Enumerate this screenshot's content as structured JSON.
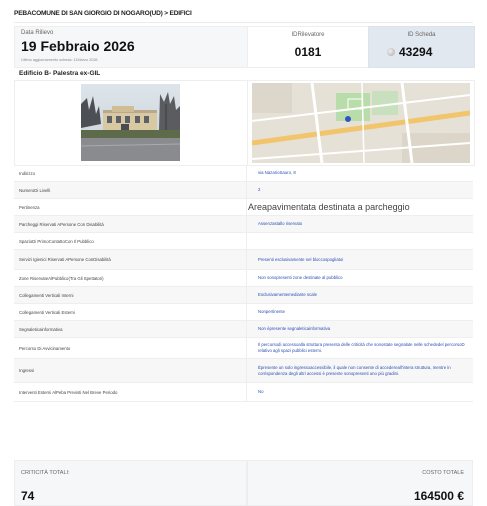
{
  "breadcrumb": "PEBACOMUNE DI SAN GIORGIO DI NOGARO(UD) > EDIFICI",
  "header": {
    "date_label": "Data Rilievo",
    "date_value": "19 Febbraio 2026",
    "updated_text": "Ultimo aggiornamento scheda: 11Marzo 2026",
    "rilevatore_label": "IDRilevatore",
    "rilevatore_value": "0181",
    "scheda_label": "ID Scheda",
    "scheda_value": "43294"
  },
  "building_name": "Edificio B- Palestra ex-GIL",
  "rows": [
    {
      "label": "Indirizzo",
      "value": "via NazarioSauro, 8"
    },
    {
      "label": "NumeroDi Livelli",
      "value": "2"
    },
    {
      "label": "Pertinenza",
      "value": "Areapavimentata destinata a parcheggio"
    },
    {
      "label": "Parcheggi Riservati APersone Con Disabilità",
      "value": "Assenzastallo riservato"
    },
    {
      "label": "SpazioDi PrimoContattoCon Il Pubblico",
      "value": ""
    },
    {
      "label": "Servizi Igienici Riservati APersone ConDisabilità",
      "value": "Presenti esclusivamente nel bloccospogliatoi"
    },
    {
      "label": "Zone RiservateAlPubblico(Tra Gli Spettatori)",
      "value": "Non sonopresenti zone destinate al pubblico"
    },
    {
      "label": "Collegamenti Verticali Interni",
      "value": "Esclusivamentemediante scale"
    },
    {
      "label": "Collegamenti Verticali Esterni",
      "value": "Nonpertinente"
    },
    {
      "label": "Segnaleticainformativa",
      "value": "Non èpresente segnaleticainformativa"
    },
    {
      "label": "Percorso Di Avvicinamento",
      "value": "Il percorsodi accessoalla struttura presenta delle criticità che sonostate segnalate nelle schededel percorsoD relativo agli spazi pubblici esterni."
    },
    {
      "label": "Ingressi",
      "value": "Èpresente un solo ingressoaccessibile, il quale non consente di accedereall'intera struttura, mentre in corrispondenza degli altri accessi è presente sonopresenti uno più gradini."
    },
    {
      "label": "Interventi Esterni AlPeba Previsti Nel Breve Periodo",
      "value": "No"
    }
  ],
  "totals": {
    "criticita_label": "CRITICITÀ TOTALI:",
    "criticita_value": "74",
    "costo_label": "COSTO TOTALE",
    "costo_value": "164500 €"
  },
  "colors": {
    "link_blue": "#2b4fb0",
    "header_id_bg": "#e2e8ef",
    "row_alt_bg": "#f7f7f8"
  },
  "icons": {
    "id_scheda": "coin-icon"
  }
}
